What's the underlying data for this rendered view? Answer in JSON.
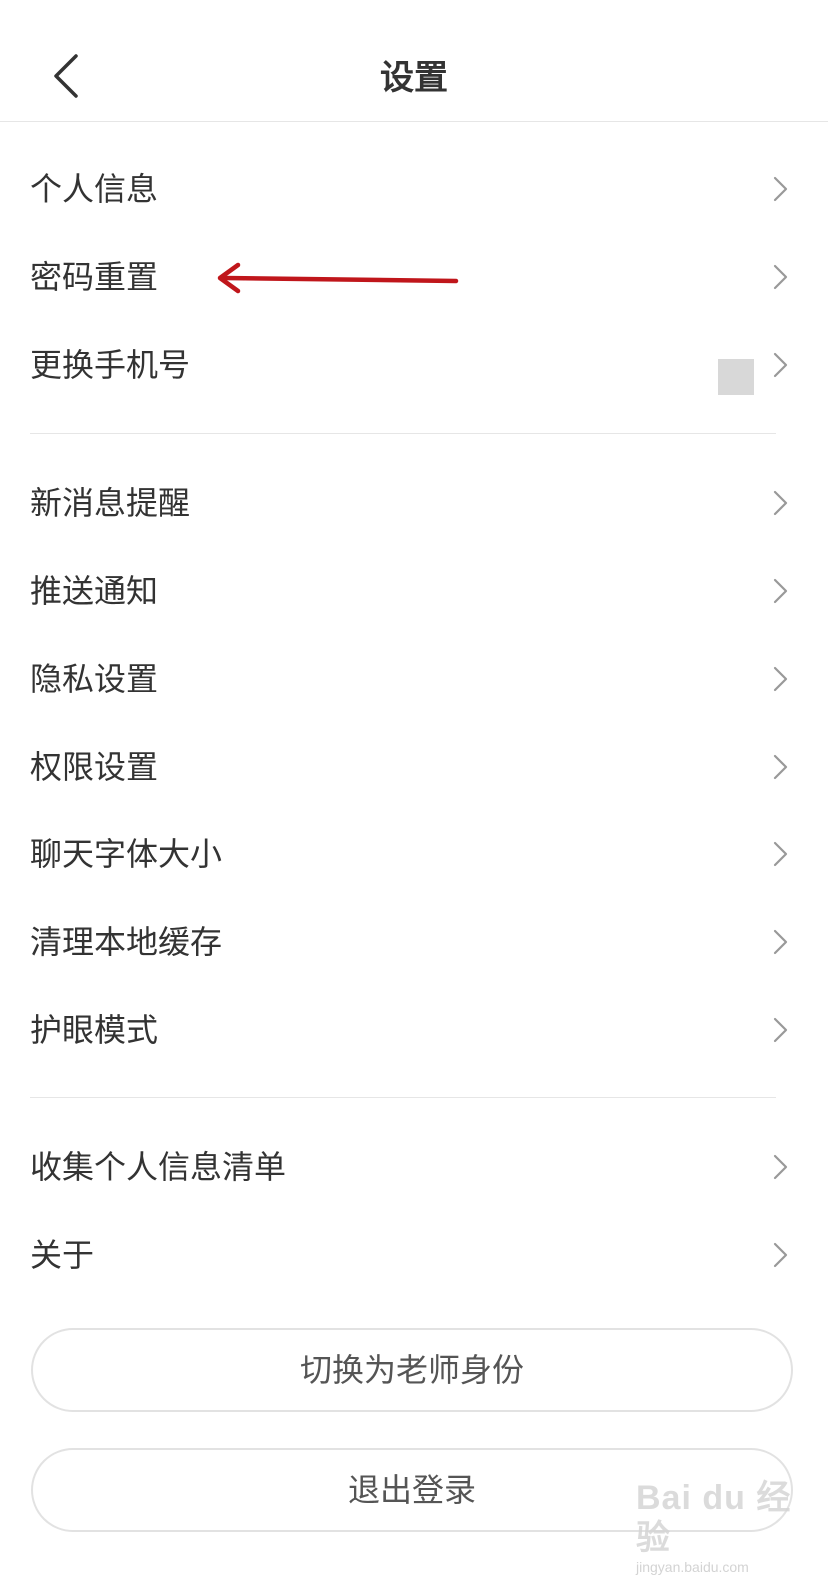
{
  "header": {
    "title": "设置",
    "back_icon": "chevron-left-icon"
  },
  "groups": [
    {
      "items": [
        {
          "label": "个人信息"
        },
        {
          "label": "密码重置"
        },
        {
          "label": "更换手机号"
        }
      ]
    },
    {
      "items": [
        {
          "label": "新消息提醒"
        },
        {
          "label": "推送通知"
        },
        {
          "label": "隐私设置"
        },
        {
          "label": "权限设置"
        },
        {
          "label": "聊天字体大小"
        },
        {
          "label": "清理本地缓存"
        },
        {
          "label": "护眼模式"
        }
      ]
    },
    {
      "items": [
        {
          "label": "收集个人信息清单"
        },
        {
          "label": "关于"
        }
      ]
    }
  ],
  "buttons": {
    "switch_role": "切换为老师身份",
    "logout": "退出登录"
  },
  "watermark": {
    "brand": "Bai du 经验",
    "url": "jingyan.baidu.com"
  },
  "colors": {
    "text": "#333333",
    "divider": "#e6e6e6",
    "chevron": "#999999",
    "annotation": "#c0161b"
  }
}
